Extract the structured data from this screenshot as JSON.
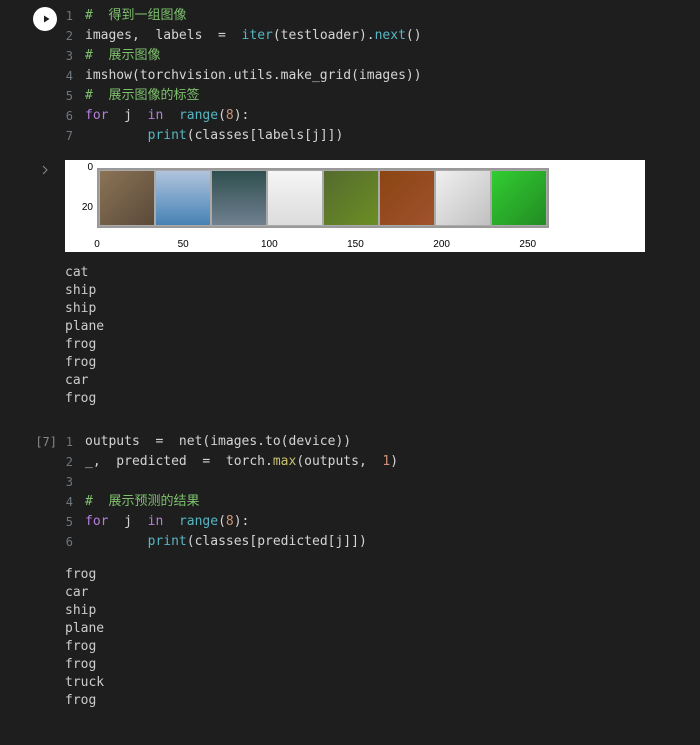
{
  "cell1": {
    "exec_indicator": "run",
    "lines": [
      {
        "n": "1",
        "tokens": [
          {
            "c": "tok-comment",
            "t": "#  得到一组图像"
          }
        ]
      },
      {
        "n": "2",
        "tokens": [
          {
            "c": "tok-default",
            "t": "images,  labels  =  "
          },
          {
            "c": "tok-builtin",
            "t": "iter"
          },
          {
            "c": "tok-default",
            "t": "(testloader)."
          },
          {
            "c": "tok-builtin",
            "t": "next"
          },
          {
            "c": "tok-default",
            "t": "()"
          }
        ]
      },
      {
        "n": "3",
        "tokens": [
          {
            "c": "tok-comment",
            "t": "#  展示图像"
          }
        ]
      },
      {
        "n": "4",
        "tokens": [
          {
            "c": "tok-default",
            "t": "imshow(torchvision.utils.make_grid(images))"
          }
        ]
      },
      {
        "n": "5",
        "tokens": [
          {
            "c": "tok-comment",
            "t": "#  展示图像的标签"
          }
        ]
      },
      {
        "n": "6",
        "tokens": [
          {
            "c": "tok-keyword",
            "t": "for"
          },
          {
            "c": "tok-default",
            "t": "  j  "
          },
          {
            "c": "tok-keyword",
            "t": "in"
          },
          {
            "c": "tok-default",
            "t": "  "
          },
          {
            "c": "tok-builtin",
            "t": "range"
          },
          {
            "c": "tok-default",
            "t": "("
          },
          {
            "c": "tok-number",
            "t": "8"
          },
          {
            "c": "tok-default",
            "t": "):"
          }
        ]
      },
      {
        "n": "7",
        "tokens": [
          {
            "c": "tok-default",
            "t": "        "
          },
          {
            "c": "tok-builtin",
            "t": "print"
          },
          {
            "c": "tok-default",
            "t": "(classes[labels[j]])"
          }
        ]
      }
    ]
  },
  "output1": {
    "labels": [
      "cat",
      "ship",
      "ship",
      "plane",
      "frog",
      "frog",
      "car",
      "frog"
    ]
  },
  "chart_data": {
    "type": "image-grid",
    "x_ticks": [
      "0",
      "50",
      "100",
      "150",
      "200",
      "250"
    ],
    "y_ticks": [
      "0",
      "20"
    ],
    "grid_cols": 8,
    "thumbnails": [
      "cat",
      "ship",
      "ship",
      "plane",
      "frog",
      "frog",
      "car",
      "frog"
    ]
  },
  "cell2": {
    "exec_count": "[7]",
    "lines": [
      {
        "n": "1",
        "tokens": [
          {
            "c": "tok-default",
            "t": "outputs  =  net(images.to(device))"
          }
        ]
      },
      {
        "n": "2",
        "tokens": [
          {
            "c": "tok-default",
            "t": "_,  predicted  =  torch."
          },
          {
            "c": "tok-func",
            "t": "max"
          },
          {
            "c": "tok-default",
            "t": "(outputs,  "
          },
          {
            "c": "tok-number",
            "t": "1"
          },
          {
            "c": "tok-default",
            "t": ")"
          }
        ]
      },
      {
        "n": "3",
        "tokens": [
          {
            "c": "tok-default",
            "t": ""
          }
        ]
      },
      {
        "n": "4",
        "tokens": [
          {
            "c": "tok-comment",
            "t": "#  展示预测的结果"
          }
        ]
      },
      {
        "n": "5",
        "tokens": [
          {
            "c": "tok-keyword",
            "t": "for"
          },
          {
            "c": "tok-default",
            "t": "  j  "
          },
          {
            "c": "tok-keyword",
            "t": "in"
          },
          {
            "c": "tok-default",
            "t": "  "
          },
          {
            "c": "tok-builtin",
            "t": "range"
          },
          {
            "c": "tok-default",
            "t": "("
          },
          {
            "c": "tok-number",
            "t": "8"
          },
          {
            "c": "tok-default",
            "t": "):"
          }
        ]
      },
      {
        "n": "6",
        "tokens": [
          {
            "c": "tok-default",
            "t": "        "
          },
          {
            "c": "tok-builtin",
            "t": "print"
          },
          {
            "c": "tok-default",
            "t": "(classes[predicted[j]])"
          }
        ]
      }
    ]
  },
  "output2": {
    "labels": [
      "frog",
      "car",
      "ship",
      "plane",
      "frog",
      "frog",
      "truck",
      "frog"
    ]
  }
}
